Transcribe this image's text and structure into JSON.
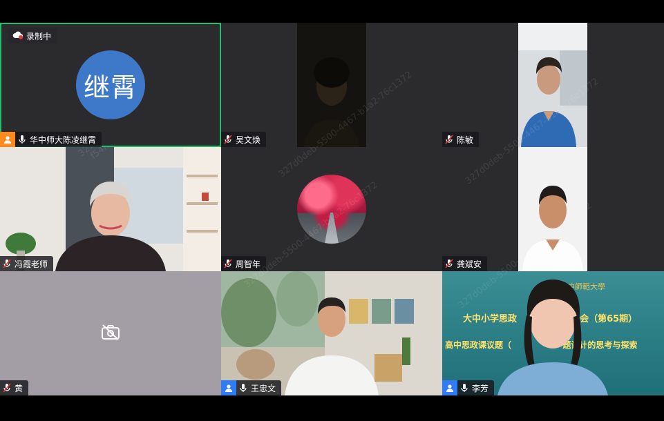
{
  "recording": {
    "label": "录制中"
  },
  "participants": [
    {
      "name": "华中师大陈凌继霄",
      "avatar_text": "继霄"
    },
    {
      "name": "吴文焕"
    },
    {
      "name": "陈敏"
    },
    {
      "name": "冯霞老师"
    },
    {
      "name": "周智年"
    },
    {
      "name": "龚斌安"
    },
    {
      "name": "黄"
    },
    {
      "name": "王忠文"
    },
    {
      "name": "李芳"
    }
  ],
  "slide": {
    "title_line1": "大中小学思政",
    "title_line2": "会（第65期）",
    "subtitle_a": "高中思政课议题（",
    "subtitle_b": "题设计的思考与探索",
    "header": "華中師範大學"
  },
  "watermark": {
    "line1": "327d0deb-5500-4467-b1a2-76c1372",
    "line2": "f54ff 未填写 1109"
  },
  "colors": {
    "active_border": "#22c06b",
    "avatar_bg": "#3d78c9",
    "user_badge_orange": "#ff8a1e",
    "user_badge_blue": "#2f7cf6"
  }
}
